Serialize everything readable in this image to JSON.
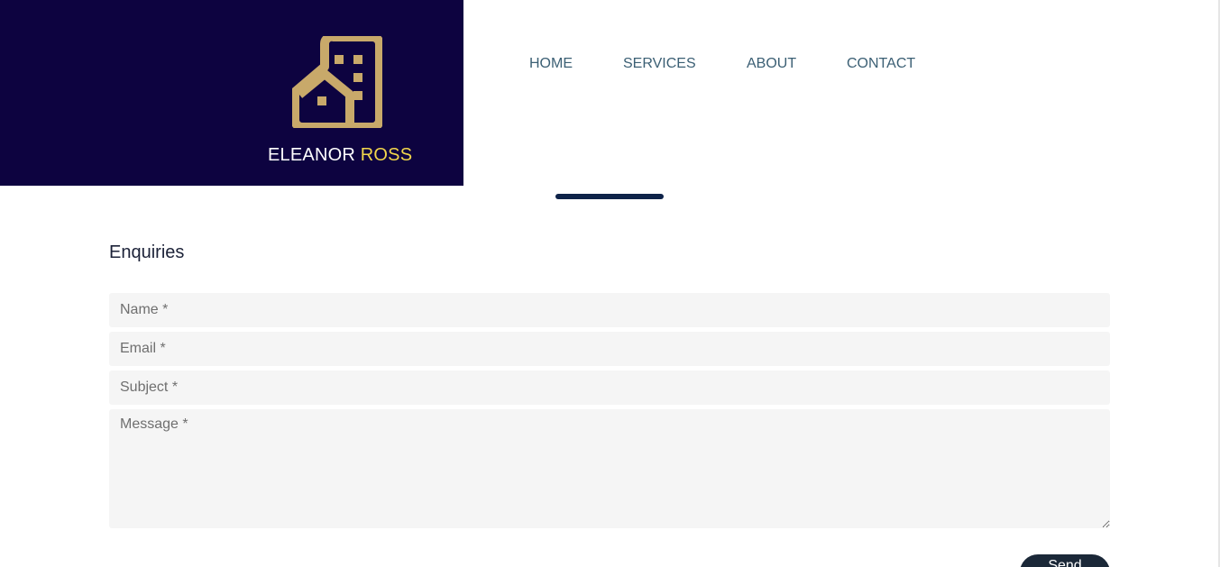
{
  "brand": {
    "name_first": "ELEANOR",
    "name_last": "ROSS",
    "logo_icon": "building-icon",
    "panel_color": "#0d0340",
    "logo_color": "#c8a96a",
    "accent_color": "#f2d64b"
  },
  "nav": {
    "items": [
      {
        "label": "HOME"
      },
      {
        "label": "SERVICES"
      },
      {
        "label": "ABOUT"
      },
      {
        "label": "CONTACT"
      }
    ],
    "color": "#3b5f74"
  },
  "enquiries": {
    "title": "Enquiries",
    "fields": {
      "name_placeholder": "Name *",
      "email_placeholder": "Email *",
      "subject_placeholder": "Subject *",
      "message_placeholder": "Message *"
    },
    "send_label": "Send"
  }
}
